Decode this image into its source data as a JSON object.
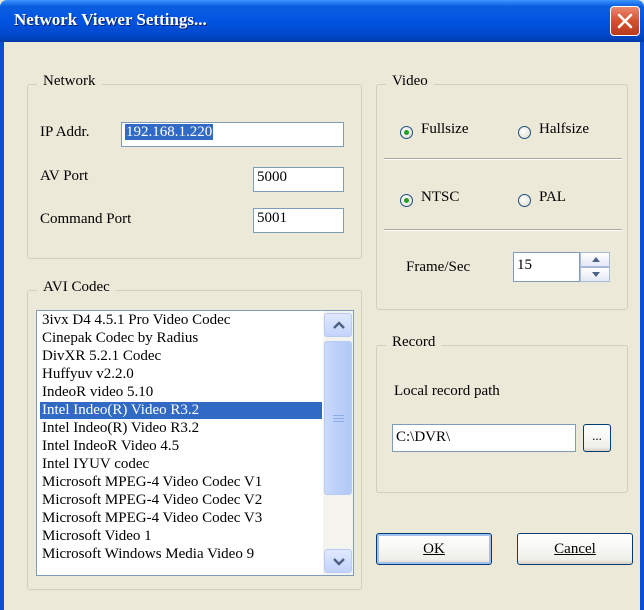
{
  "window": {
    "title": "Network Viewer Settings..."
  },
  "network": {
    "legend": "Network",
    "ip_label": "IP Addr.",
    "ip_value": "192.168.1.220",
    "av_port_label": "AV Port",
    "av_port_value": "5000",
    "command_port_label": "Command Port",
    "command_port_value": "5001"
  },
  "video": {
    "legend": "Video",
    "size_options": [
      "Fullsize",
      "Halfsize"
    ],
    "size_selected": "Fullsize",
    "standard_options": [
      "NTSC",
      "PAL"
    ],
    "standard_selected": "NTSC",
    "frame_label": "Frame/Sec",
    "frame_value": "15"
  },
  "codec": {
    "legend": "AVI Codec",
    "items": [
      "3ivx D4 4.5.1 Pro Video Codec",
      "Cinepak Codec by Radius",
      "DivXR 5.2.1 Codec",
      "Huffyuv v2.2.0",
      "IndeoR video 5.10",
      "Intel Indeo(R) Video R3.2",
      "Intel Indeo(R) Video R3.2",
      "Intel IndeoR Video 4.5",
      "Intel IYUV codec",
      "Microsoft MPEG-4 Video Codec V1",
      "Microsoft MPEG-4 Video Codec V2",
      "Microsoft MPEG-4 Video Codec V3",
      "Microsoft Video 1",
      "Microsoft Windows Media Video 9"
    ],
    "selected_index": 5
  },
  "record": {
    "legend": "Record",
    "path_label": "Local record path",
    "path_value": "C:\\DVR\\",
    "browse_label": "..."
  },
  "buttons": {
    "ok": "OK",
    "cancel": "Cancel"
  },
  "icons": {
    "close": "close-icon",
    "scroll_up": "chevron-up-icon",
    "scroll_down": "chevron-down-icon",
    "spin_up": "triangle-up-icon",
    "spin_down": "triangle-down-icon"
  },
  "colors": {
    "title_bar": "#0054E3",
    "selection": "#316AC5",
    "dialog_bg": "#ECE9D8",
    "close_button": "#D5512D"
  }
}
